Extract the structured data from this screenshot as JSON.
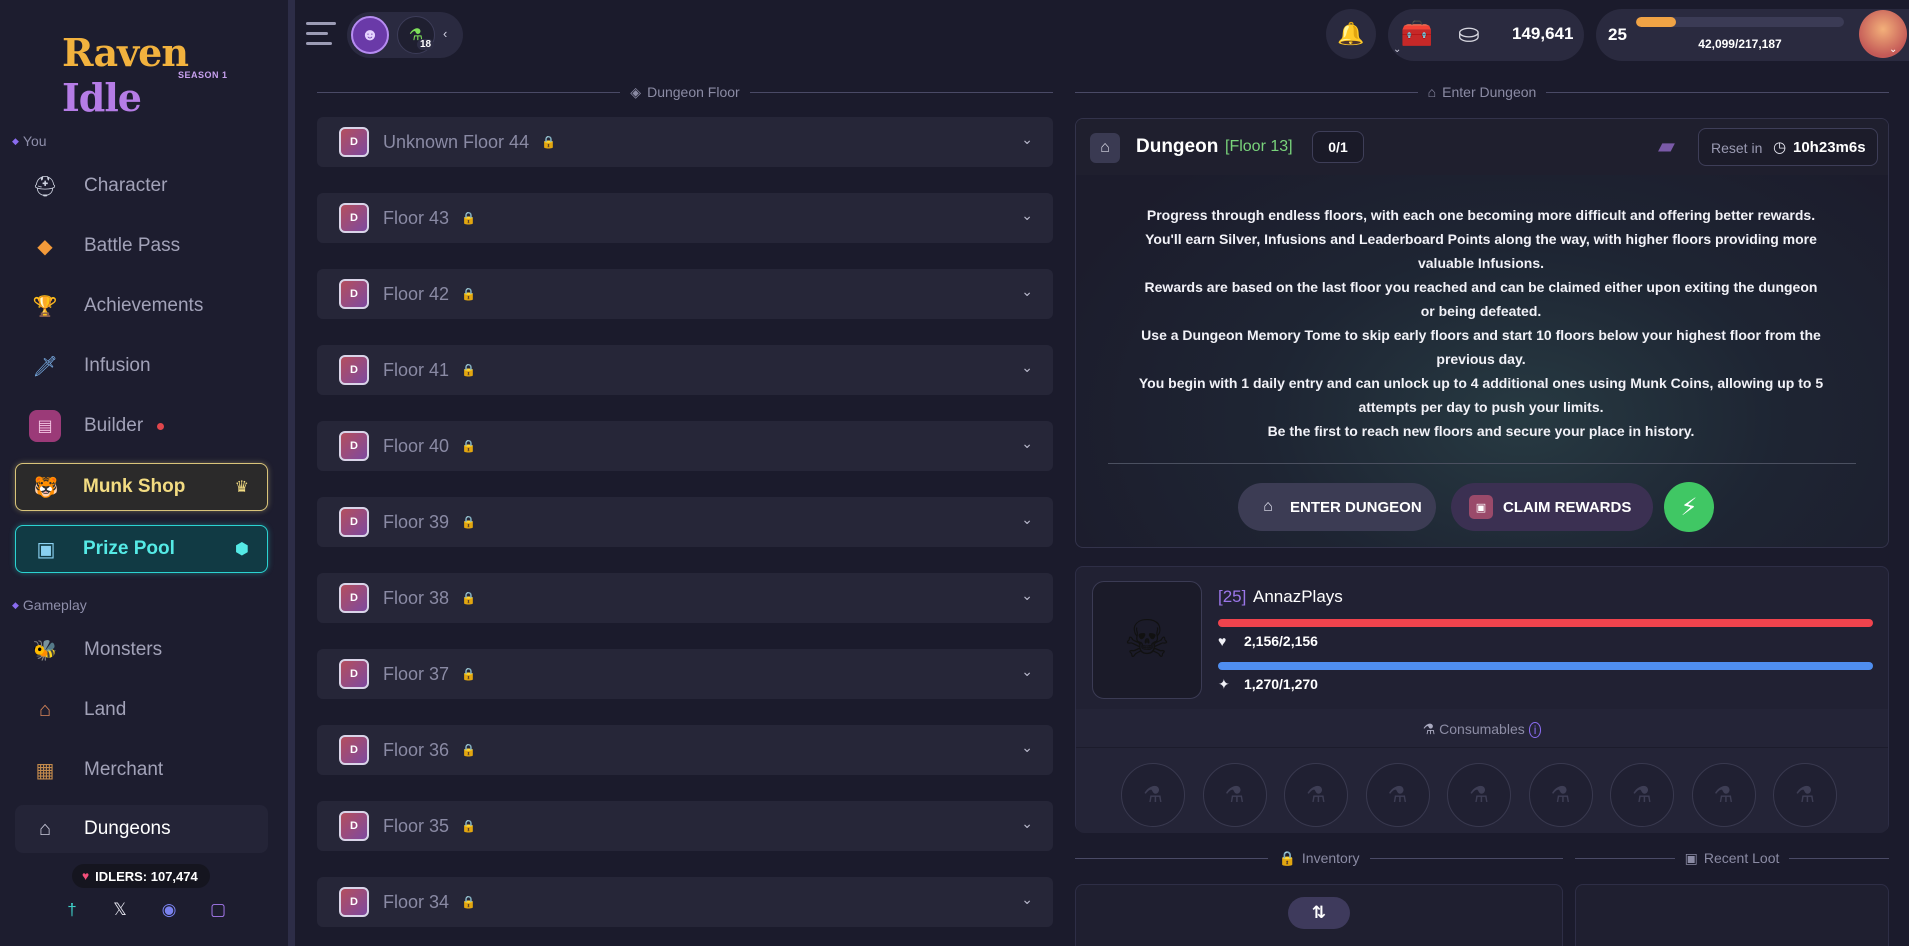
{
  "app": {
    "logo_main": "Raven",
    "logo_idle": "Idle",
    "logo_season": "SEASON 1"
  },
  "sidebar": {
    "section_you": "You",
    "section_gameplay": "Gameplay",
    "items": [
      {
        "label": "Character",
        "icon": "knight-helmet-icon"
      },
      {
        "label": "Battle Pass",
        "icon": "gem-icon"
      },
      {
        "label": "Achievements",
        "icon": "trophy-icon"
      },
      {
        "label": "Infusion",
        "icon": "sword-icon"
      },
      {
        "label": "Builder",
        "icon": "book-icon"
      },
      {
        "label": "Munk Shop",
        "icon": "munk-icon"
      },
      {
        "label": "Prize Pool",
        "icon": "prize-chest-icon"
      },
      {
        "label": "Monsters",
        "icon": "wasp-icon"
      },
      {
        "label": "Land",
        "icon": "house-icon"
      },
      {
        "label": "Merchant",
        "icon": "merchant-stall-icon"
      },
      {
        "label": "Dungeons",
        "icon": "dungeon-door-icon"
      }
    ],
    "idlers_label": "IDLERS: 107,474"
  },
  "topbar": {
    "buff_count": "18",
    "silver": "149,641",
    "level": "25",
    "xp_text": "42,099/217,187",
    "xp_fraction": 0.194
  },
  "floors_header": "Dungeon Floor",
  "floors": [
    "Unknown Floor 44",
    "Floor 43",
    "Floor 42",
    "Floor 41",
    "Floor 40",
    "Floor 39",
    "Floor 38",
    "Floor 37",
    "Floor 36",
    "Floor 35",
    "Floor 34"
  ],
  "enter_header": "Enter Dungeon",
  "dungeon": {
    "title": "Dungeon",
    "floor_tag": "[Floor 13]",
    "entries": "0/1",
    "reset_label": "Reset in",
    "reset_time": "10h23m6s",
    "description": [
      "Progress through endless floors, with each one becoming more difficult and offering better rewards.",
      "You'll earn Silver, Infusions and Leaderboard Points along the way, with higher floors providing more valuable Infusions.",
      "Rewards are based on the last floor you reached and can be claimed either upon exiting the dungeon or being defeated.",
      "Use a Dungeon Memory Tome to skip early floors and start 10 floors below your highest floor from the previous day.",
      "You begin with 1 daily entry and can unlock up to 4 additional ones using Munk Coins, allowing up to 5 attempts per day to push your limits.",
      "Be the first to reach new floors and secure your place in history."
    ],
    "enter_button": "ENTER DUNGEON",
    "claim_button": "CLAIM REWARDS"
  },
  "character": {
    "level": "[25]",
    "name": "AnnazPlays",
    "hp_text": "2,156/2,156",
    "mp_text": "1,270/1,270",
    "consumables_title": "Consumables",
    "consumable_slots": 9
  },
  "inventory_header": "Inventory",
  "recent_loot_header": "Recent Loot",
  "colors": {
    "accent_purple": "#8a6cf0",
    "hp": "#f0434d",
    "mana": "#4f8ef0",
    "xp": "#f0a345",
    "floor_green": "#79d37b"
  }
}
